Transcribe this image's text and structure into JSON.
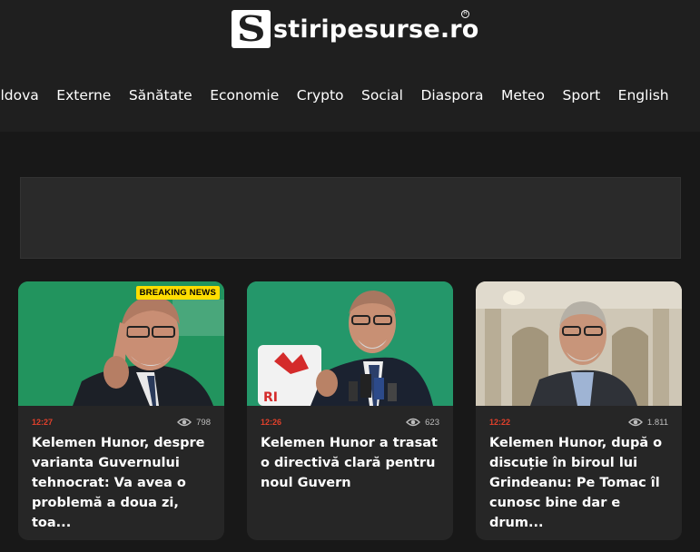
{
  "site": {
    "logo_letter": "S",
    "logo_text": "stiripesurse.ro",
    "reg_mark": "R"
  },
  "nav": {
    "items": [
      "oldova",
      "Externe",
      "Sănătate",
      "Economie",
      "Crypto",
      "Social",
      "Diaspora",
      "Meteo",
      "Sport",
      "English"
    ]
  },
  "articles": [
    {
      "badge": "BREAKING NEWS",
      "time": "12:27",
      "views": "798",
      "title": "Kelemen Hunor, despre varianta Guvernului tehnocrat: Va avea o problemă a doua zi, toa..."
    },
    {
      "badge": "",
      "time": "12:26",
      "views": "623",
      "title": "Kelemen Hunor a trasat o directivă clară pentru noul Guvern"
    },
    {
      "badge": "",
      "time": "12:22",
      "views": "1.811",
      "title": "Kelemen Hunor, după o discuție în biroul lui Grindeanu: Pe Tomac îl cunosc bine dar e drum..."
    }
  ],
  "colors": {
    "background": "#181818",
    "header": "#1f1f1f",
    "card": "#262626",
    "time_accent": "#e0402b",
    "badge": "#ffdd00"
  },
  "icons": {
    "views": "eye-icon"
  }
}
